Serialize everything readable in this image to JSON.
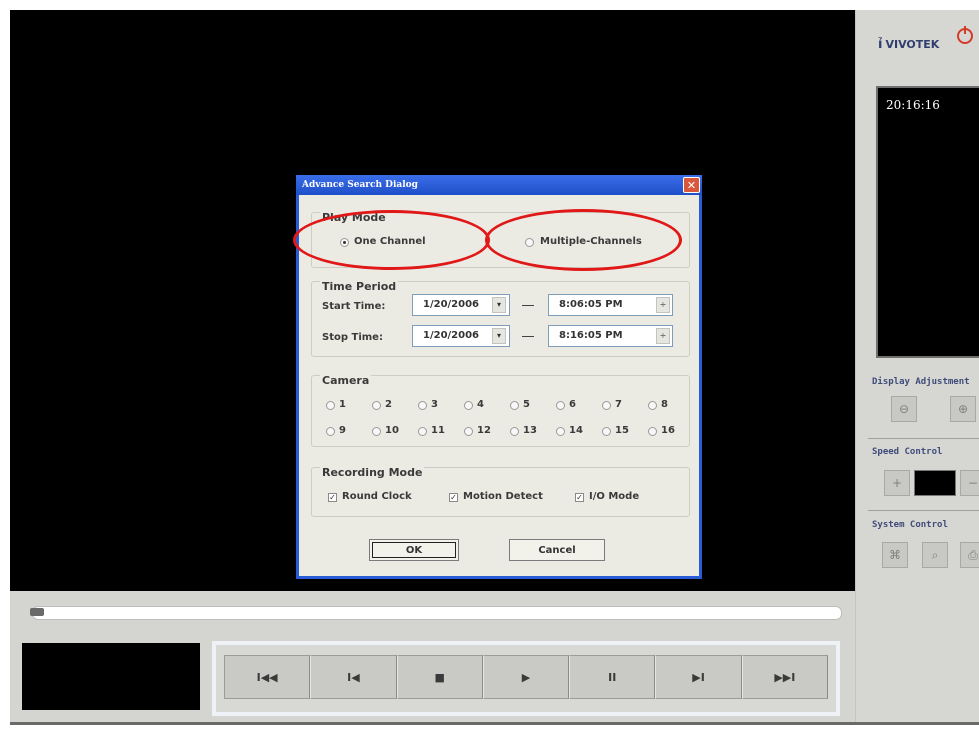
{
  "brand": {
    "logo_text": "VIVOTEK"
  },
  "preview": {
    "time": "20:16:16"
  },
  "side_panel": {
    "display_adjustment": "Display Adjustment",
    "speed_control": "Speed Control",
    "system_control": "System Control"
  },
  "transport": {
    "buttons": [
      "I◀◀",
      "I◀",
      "■",
      "▶",
      "II",
      "▶I",
      "▶▶I"
    ],
    "icons": [
      "skip-to-start-icon",
      "previous-frame-icon",
      "stop-icon",
      "play-icon",
      "pause-icon",
      "next-frame-icon",
      "skip-to-end-icon"
    ]
  },
  "dialog": {
    "title": "Advance Search Dialog",
    "close_glyph": "✕",
    "play_mode": {
      "title": "Play Mode",
      "one_channel": "One Channel",
      "multiple_channels": "Multiple-Channels",
      "selected": "one_channel"
    },
    "time_period": {
      "title": "Time Period",
      "start_label": "Start Time:",
      "stop_label": "Stop Time:",
      "start_date": "1/20/2006",
      "start_time": "8:06:05 PM",
      "stop_date": "1/20/2006",
      "stop_time": "8:16:05 PM"
    },
    "camera": {
      "title": "Camera",
      "channels": [
        "1",
        "2",
        "3",
        "4",
        "5",
        "6",
        "7",
        "8",
        "9",
        "10",
        "11",
        "12",
        "13",
        "14",
        "15",
        "16"
      ]
    },
    "recording_mode": {
      "title": "Recording Mode",
      "round_clock": "Round Clock",
      "motion_detect": "Motion Detect",
      "io_mode": "I/O Mode",
      "checked": [
        true,
        true,
        true
      ]
    },
    "ok": "OK",
    "cancel": "Cancel"
  },
  "colors": {
    "annotation": "#e01818",
    "titlebar": "#2a5bd6"
  }
}
